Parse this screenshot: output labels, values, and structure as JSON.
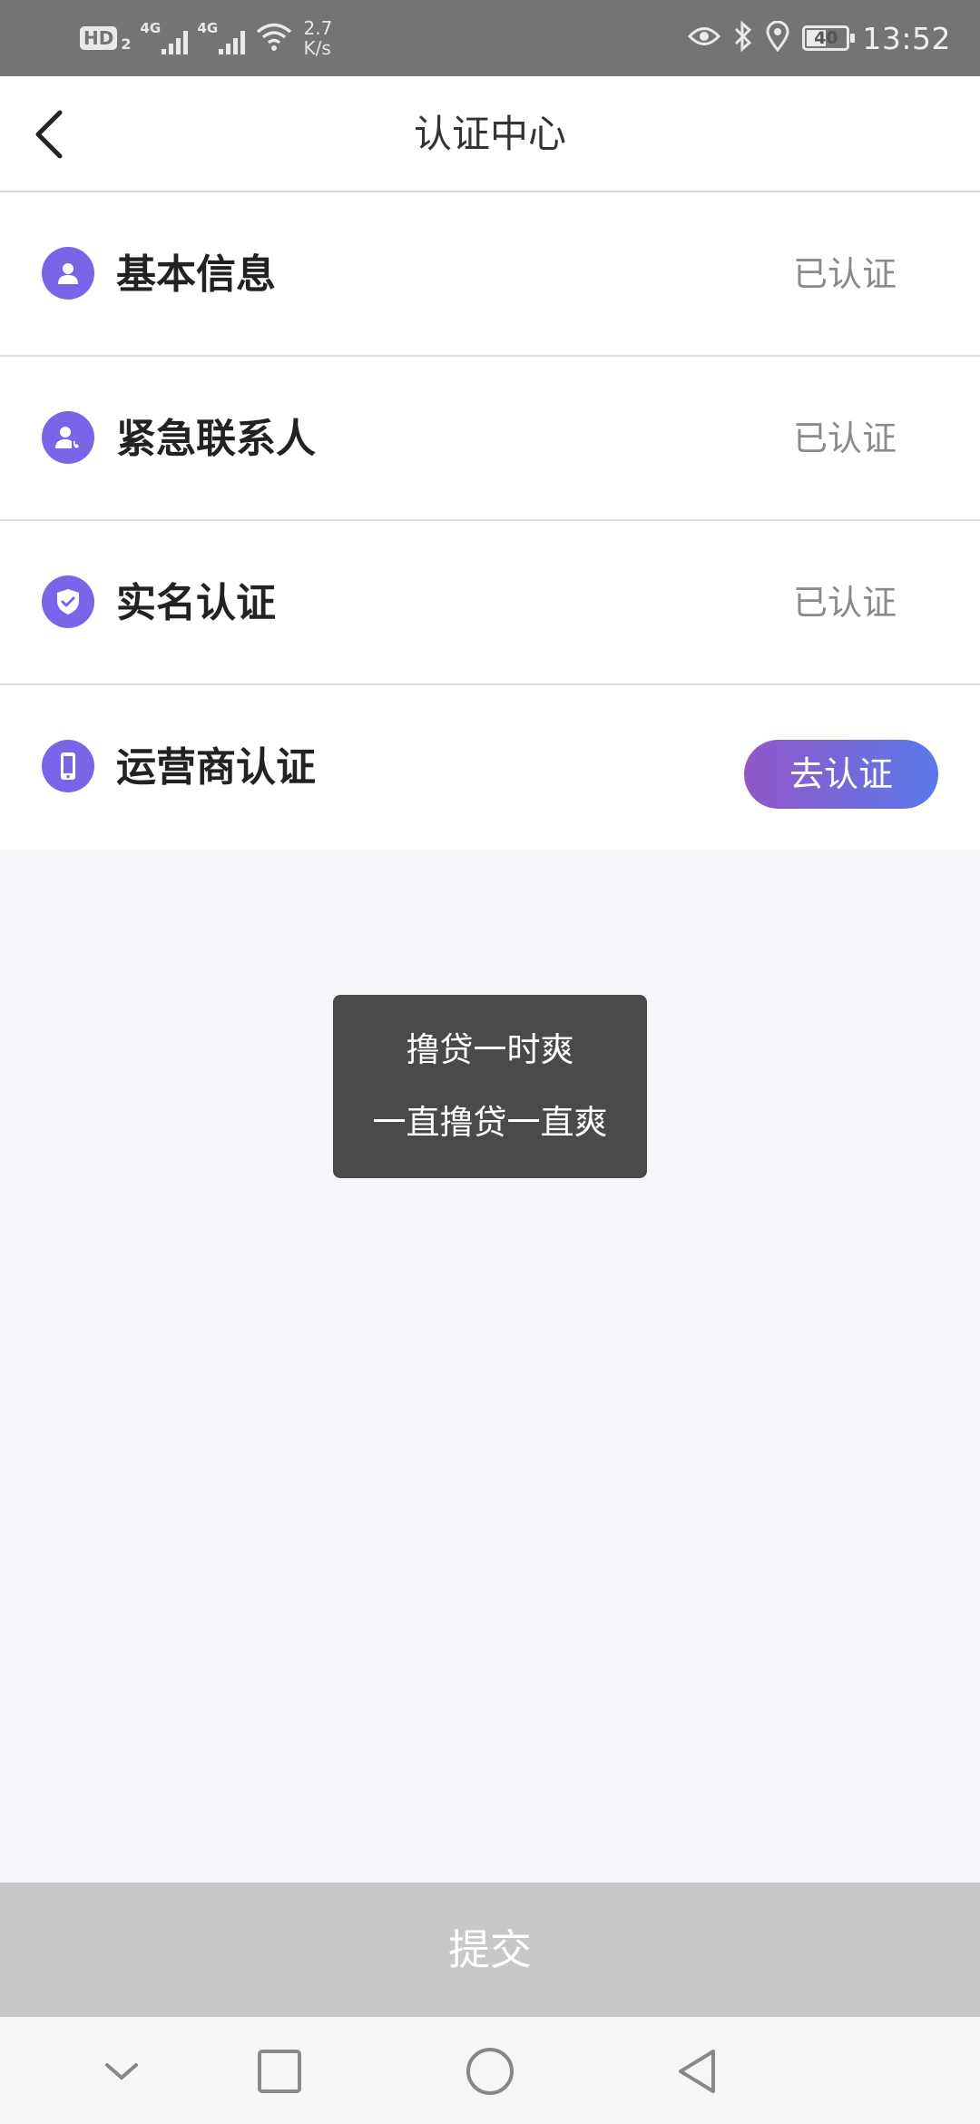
{
  "status_bar": {
    "hd_label": "HD",
    "hd_sub": "2",
    "network_1": "4G",
    "network_2": "4G",
    "speed_value": "2.7",
    "speed_unit": "K/s",
    "battery": "40",
    "time": "13:52"
  },
  "header": {
    "title": "认证中心"
  },
  "rows": [
    {
      "label": "基本信息",
      "status": "已认证",
      "icon": "user-icon"
    },
    {
      "label": "紧急联系人",
      "status": "已认证",
      "icon": "contact-phone-icon"
    },
    {
      "label": "实名认证",
      "status": "已认证",
      "icon": "shield-check-icon"
    },
    {
      "label": "运营商认证",
      "button": "去认证",
      "icon": "mobile-phone-icon"
    }
  ],
  "toast": {
    "line1": "撸贷一时爽",
    "line2": "一直撸贷一直爽"
  },
  "submit": {
    "label": "提交"
  },
  "colors": {
    "accent_icon": "#7b64e8",
    "button_gradient_start": "#9157c8",
    "button_gradient_end": "#5b79e9",
    "submit_disabled": "#c8c8ca"
  }
}
